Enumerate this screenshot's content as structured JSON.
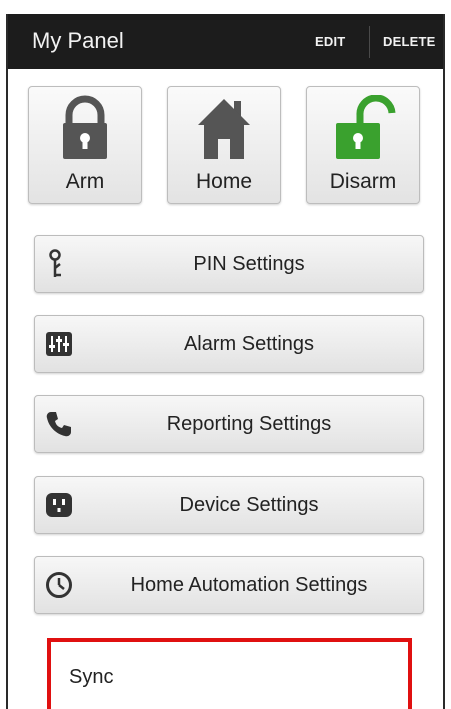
{
  "appbar": {
    "title": "My Panel",
    "edit_label": "EDIT",
    "delete_label": "DELETE"
  },
  "quick_actions": [
    {
      "label": "Arm",
      "icon": "lock-closed-icon",
      "icon_color": "#555555"
    },
    {
      "label": "Home",
      "icon": "house-icon",
      "icon_color": "#555555"
    },
    {
      "label": "Disarm",
      "icon": "lock-open-icon",
      "icon_color": "#3aa12e"
    }
  ],
  "settings_items": [
    {
      "label": "PIN Settings",
      "icon": "key-icon"
    },
    {
      "label": "Alarm Settings",
      "icon": "sliders-icon"
    },
    {
      "label": "Reporting Settings",
      "icon": "phone-icon"
    },
    {
      "label": "Device Settings",
      "icon": "outlet-icon"
    },
    {
      "label": "Home Automation Settings",
      "icon": "clock-icon"
    }
  ],
  "sync": {
    "label": "Sync",
    "highlight_color": "#e01010"
  }
}
